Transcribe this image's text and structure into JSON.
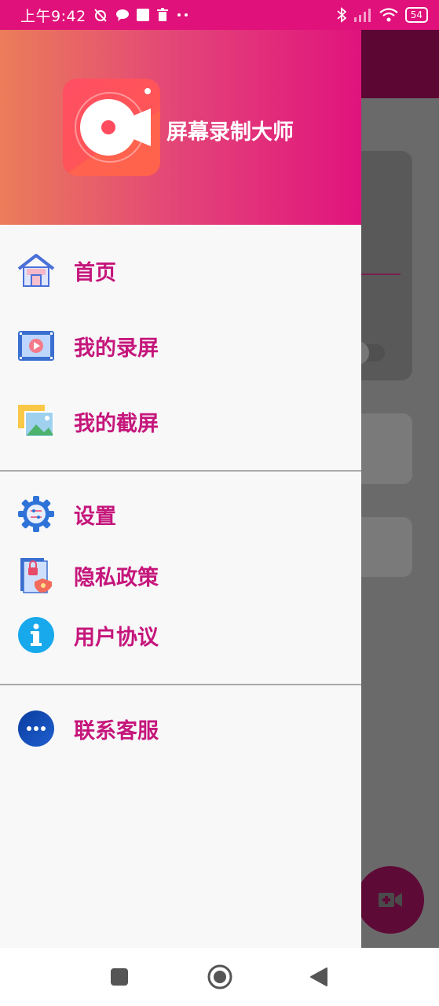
{
  "status_bar": {
    "time": "上午9:42",
    "battery": "54",
    "icons": [
      "mute-alarm-icon",
      "chat-bubble-icon",
      "gallery-icon",
      "trash-icon",
      "more-dots-icon",
      "bluetooth-icon",
      "signal-icon",
      "wifi-icon",
      "battery-icon"
    ]
  },
  "drawer": {
    "app_name": "屏幕录制大师",
    "groups": [
      {
        "items": [
          {
            "label": "首页",
            "icon": "home-store-icon"
          },
          {
            "label": "我的录屏",
            "icon": "video-film-icon"
          },
          {
            "label": "我的截屏",
            "icon": "image-gallery-icon"
          }
        ]
      },
      {
        "items": [
          {
            "label": "设置",
            "icon": "gear-settings-icon"
          },
          {
            "label": "隐私政策",
            "icon": "privacy-document-icon"
          },
          {
            "label": "用户协议",
            "icon": "info-icon"
          }
        ]
      },
      {
        "items": [
          {
            "label": "联系客服",
            "icon": "more-chat-icon"
          }
        ]
      }
    ]
  },
  "colors": {
    "status_bar": "#e0117a",
    "accent": "#c5167b",
    "header_gradient_start": "#eb7d5a",
    "header_gradient_end": "#e0137d"
  },
  "nav_bar": {
    "buttons": [
      "recents-square-icon",
      "home-circle-icon",
      "back-triangle-icon"
    ]
  }
}
